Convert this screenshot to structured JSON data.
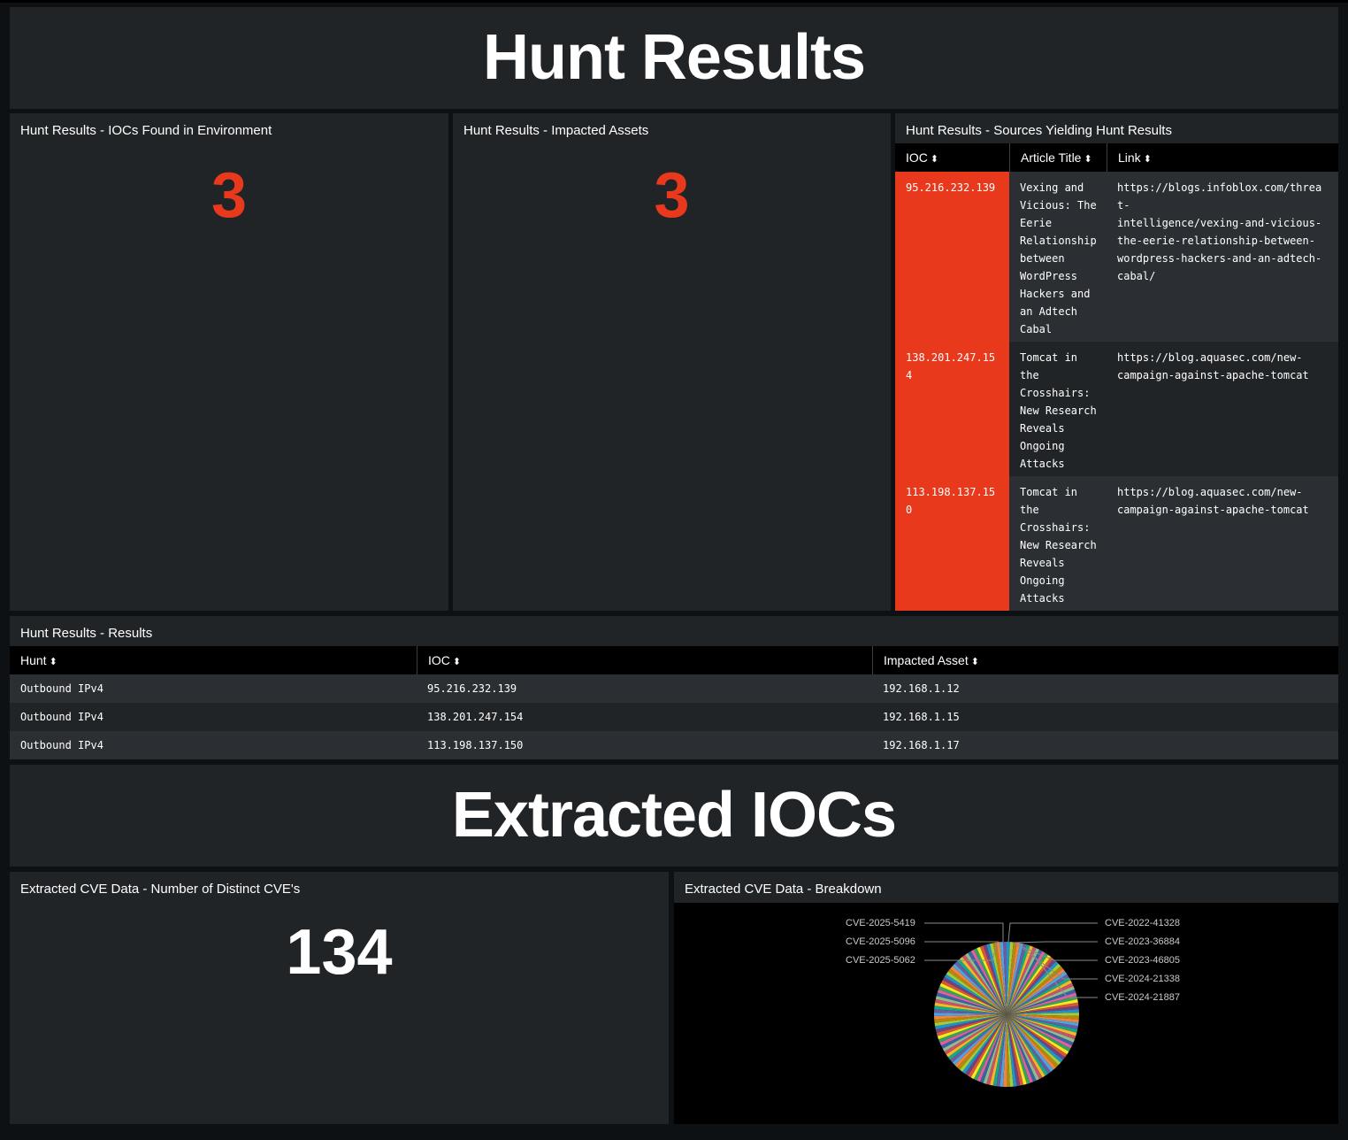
{
  "hunt_banner": {
    "title": "Hunt Results"
  },
  "iocs_found": {
    "title": "Hunt Results - IOCs Found in Environment",
    "value": "3",
    "color": "#e8391c"
  },
  "impacted_assets": {
    "title": "Hunt Results - Impacted Assets",
    "value": "3",
    "color": "#e8391c"
  },
  "sources": {
    "title": "Hunt Results - Sources Yielding Hunt Results",
    "columns": [
      "IOC",
      "Article Title",
      "Link"
    ],
    "rows": [
      {
        "ioc": "95.216.232.139",
        "title": "Vexing and\nVicious: The\nEerie\nRelationship\nbetween\nWordPress\nHackers and\nan Adtech\nCabal",
        "link": "https://blogs.infoblox.com/threat-\nintelligence/vexing-and-vicious-\nthe-eerie-relationship-between-\nwordpress-hackers-and-an-adtech-\ncabal/"
      },
      {
        "ioc": "138.201.247.154",
        "title": "Tomcat in\nthe\nCrosshairs:\nNew Research\nReveals\nOngoing\nAttacks",
        "link": "https://blog.aquasec.com/new-\ncampaign-against-apache-tomcat"
      },
      {
        "ioc": "113.198.137.150",
        "title": "Tomcat in\nthe\nCrosshairs:\nNew Research\nReveals\nOngoing\nAttacks",
        "link": "https://blog.aquasec.com/new-\ncampaign-against-apache-tomcat"
      }
    ],
    "ioc_highlight": "#e8391c"
  },
  "results": {
    "title": "Hunt Results - Results",
    "columns": [
      "Hunt",
      "IOC",
      "Impacted Asset"
    ],
    "rows": [
      [
        "Outbound IPv4",
        "95.216.232.139",
        "192.168.1.12"
      ],
      [
        "Outbound IPv4",
        "138.201.247.154",
        "192.168.1.15"
      ],
      [
        "Outbound IPv4",
        "113.198.137.150",
        "192.168.1.17"
      ]
    ]
  },
  "extracted_banner": {
    "title": "Extracted IOCs"
  },
  "cve_count": {
    "title": "Extracted CVE Data - Number of Distinct CVE's",
    "value": "134",
    "color": "#ffffff"
  },
  "cve_breakdown": {
    "title": "Extracted CVE Data - Breakdown",
    "labels_left": [
      "CVE-2025-5419",
      "CVE-2025-5096",
      "CVE-2025-5062"
    ],
    "labels_right": [
      "CVE-2022-41328",
      "CVE-2023-36884",
      "CVE-2023-46805",
      "CVE-2024-21338",
      "CVE-2024-21887"
    ]
  },
  "chart_data": {
    "type": "pie",
    "title": "Extracted CVE Data - Breakdown",
    "slice_count": 134,
    "labeled_slices": [
      "CVE-2025-5419",
      "CVE-2025-5096",
      "CVE-2025-5062",
      "CVE-2022-41328",
      "CVE-2023-36884",
      "CVE-2023-46805",
      "CVE-2024-21338",
      "CVE-2024-21887"
    ],
    "palette": [
      "#1e93c6",
      "#f2b827",
      "#d6563c",
      "#6a5c9e",
      "#31a35f",
      "#ed8440",
      "#3863a0",
      "#a2cc3e",
      "#cc5068",
      "#73427f",
      "#11a88b",
      "#f8e71c",
      "#4fa3e3",
      "#e05fa1",
      "#b8860b",
      "#8fbc8f"
    ]
  }
}
